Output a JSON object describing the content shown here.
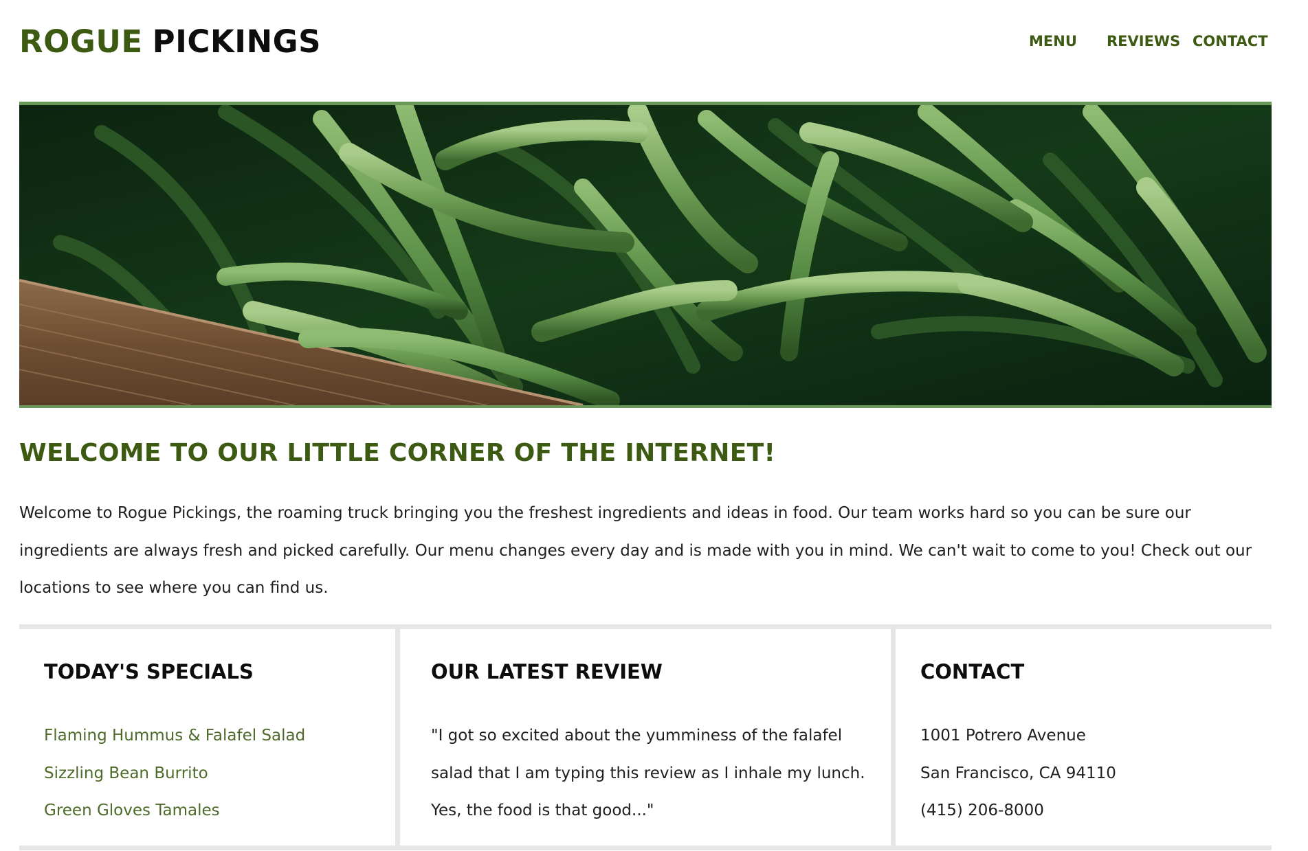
{
  "header": {
    "logo_part1": "ROGUE",
    "logo_part2": "PICKINGS",
    "nav": {
      "menu": "MENU",
      "reviews": "REVIEWS",
      "contact": "CONTACT"
    }
  },
  "welcome": {
    "title": "WELCOME TO OUR LITTLE CORNER OF THE INTERNET!",
    "body": "Welcome to Rogue Pickings, the roaming truck bringing you the freshest ingredients and ideas in food. Our team works hard so you can be sure our ingredients are always fresh and picked carefully. Our menu changes every day and is made with you in mind. We can't wait to come to you! Check out our locations to see where you can find us."
  },
  "specials": {
    "title": "TODAY'S SPECIALS",
    "items": [
      "Flaming Hummus & Falafel Salad",
      "Sizzling Bean Burrito",
      "Green Gloves Tamales"
    ]
  },
  "review": {
    "title": "OUR LATEST REVIEW",
    "quote": "\"I got so excited about the yumminess of the falafel salad that I am typing this review as I inhale my lunch. Yes, the food is that good...\""
  },
  "contact": {
    "title": "CONTACT",
    "address_line1": "1001 Potrero Avenue",
    "address_line2": "San Francisco, CA 94110",
    "phone": "(415) 206-8000"
  },
  "colors": {
    "brand_green": "#3d5a12",
    "link_green": "#4e6a2a",
    "hero_border": "#6a9858",
    "divider_gray": "#e6e6e6"
  }
}
